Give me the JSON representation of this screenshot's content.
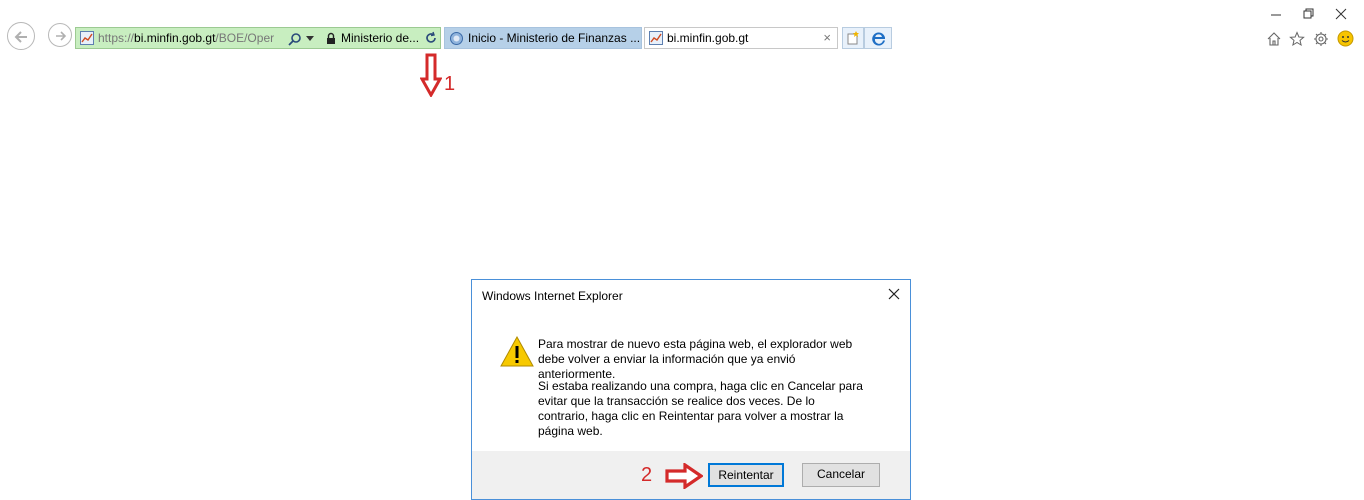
{
  "browser": {
    "address": {
      "url_prefix": "https://",
      "url_host": "bi.minfin.gob.gt",
      "url_path": "/BOE/Oper",
      "site_name": "Ministerio de..."
    },
    "tabs": [
      {
        "title": "Inicio - Ministerio de Finanzas ..."
      },
      {
        "title": "bi.minfin.gob.gt",
        "close": "×"
      }
    ]
  },
  "annotations": {
    "step1": "1",
    "step2": "2"
  },
  "dialog": {
    "title": "Windows Internet Explorer",
    "message1": "Para mostrar de nuevo esta página web, el explorador web debe volver a enviar la información que ya envió anteriormente.",
    "message2": "Si estaba realizando una compra, haga clic en Cancelar para evitar que la transacción se realice dos veces. De lo contrario, haga clic en Reintentar para volver a mostrar la página web.",
    "retry_label": "Reintentar",
    "cancel_label": "Cancelar"
  },
  "colors": {
    "address_bar": "#c8eec0",
    "active_tab": "#b6d0e8",
    "annotation": "#d42a2a",
    "dialog_border": "#4a90d9",
    "warning": "#f7c900"
  },
  "icons": [
    "back-icon",
    "forward-icon",
    "site-favicon",
    "search-icon",
    "dropdown-icon",
    "lock-icon",
    "refresh-icon",
    "ie-favicon",
    "close-icon",
    "new-tab-icon",
    "edge-icon",
    "minimize-icon",
    "restore-icon",
    "home-icon",
    "favorites-star-icon",
    "settings-gear-icon",
    "smiley-feedback-icon",
    "warning-icon",
    "arrow-down-icon",
    "arrow-right-icon"
  ]
}
